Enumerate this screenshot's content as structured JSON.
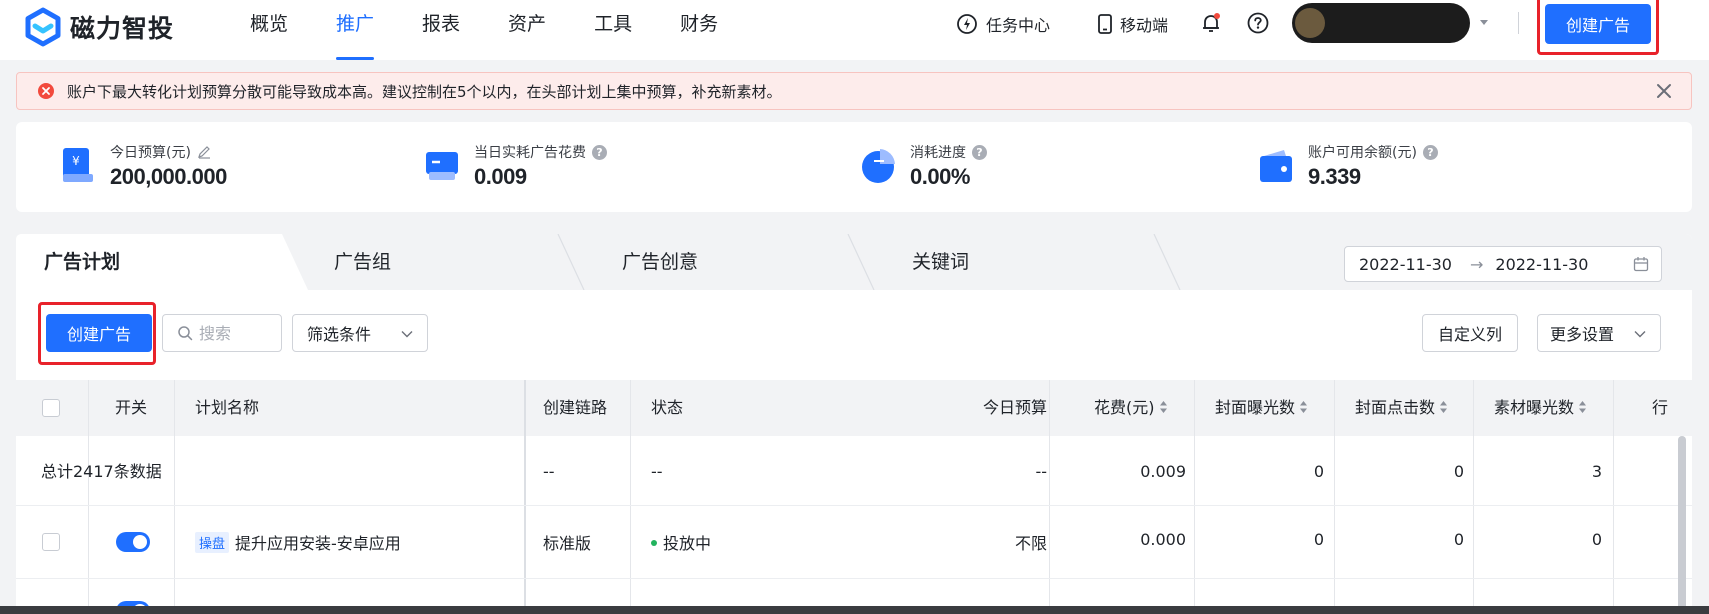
{
  "brand": {
    "name": "磁力智投",
    "accent": "#1f6fff",
    "alert_red": "#e8222a"
  },
  "nav": {
    "items": [
      {
        "label": "概览",
        "active": false
      },
      {
        "label": "推广",
        "active": true
      },
      {
        "label": "报表",
        "active": false
      },
      {
        "label": "资产",
        "active": false
      },
      {
        "label": "工具",
        "active": false
      },
      {
        "label": "财务",
        "active": false
      }
    ],
    "task_center": "任务中心",
    "mobile": "移动端",
    "create_ad": "创建广告"
  },
  "alert": {
    "text": "账户下最大转化计划预算分散可能导致成本高。建议控制在5个以内，在头部计划上集中预算，补充新素材。"
  },
  "stats": [
    {
      "label": "今日预算(元)",
      "value": "200,000.000",
      "icon": "wallet-icon",
      "color": "#1f6fff"
    },
    {
      "label": "当日实耗广告花费",
      "value": "0.009",
      "icon": "card-icon",
      "color": "#1f6fff"
    },
    {
      "label": "消耗进度",
      "value": "0.00%",
      "icon": "pie-icon",
      "color": "#1f6fff"
    },
    {
      "label": "账户可用余额(元)",
      "value": "9.339",
      "icon": "purse-icon",
      "color": "#1f6fff"
    }
  ],
  "tabs": [
    {
      "label": "广告计划",
      "active": true
    },
    {
      "label": "广告组",
      "active": false
    },
    {
      "label": "广告创意",
      "active": false
    },
    {
      "label": "关键词",
      "active": false
    }
  ],
  "date_range": {
    "start": "2022-11-30",
    "separator": "→",
    "end": "2022-11-30"
  },
  "toolbar": {
    "create_ad": "创建广告",
    "search_placeholder": "搜索",
    "filter": "筛选条件",
    "custom_columns": "自定义列",
    "more_settings": "更多设置"
  },
  "table": {
    "headers": {
      "toggle": "开关",
      "name": "计划名称",
      "chain": "创建链路",
      "status": "状态",
      "budget": "今日预算",
      "spend": "花费(元)",
      "cover_impr": "封面曝光数",
      "cover_clicks": "封面点击数",
      "material_impr": "素材曝光数",
      "more": "行"
    },
    "total_row": {
      "label": "总计2417条数据",
      "chain": "--",
      "status": "--",
      "budget": "--",
      "spend": "0.009",
      "cover_impr": "0",
      "cover_clicks": "0",
      "material_impr": "3"
    },
    "rows": [
      {
        "toggle_on": true,
        "tag": "操盘",
        "name": "提升应用安装-安卓应用",
        "chain": "标准版",
        "status": "投放中",
        "budget": "不限",
        "spend": "0.000",
        "cover_impr": "0",
        "cover_clicks": "0",
        "material_impr": "0"
      }
    ]
  }
}
